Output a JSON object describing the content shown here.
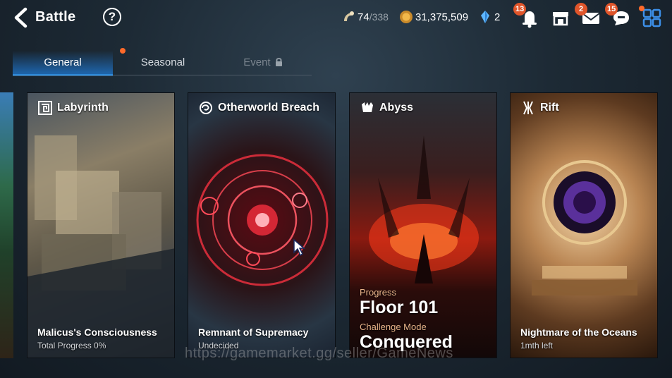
{
  "header": {
    "title": "Battle",
    "help_symbol": "?",
    "stamina": {
      "current": "74",
      "max": "/338"
    },
    "gold": "31,375,509",
    "crystal": "2",
    "badges": {
      "notifications": "13",
      "mail": "2",
      "chat": "15"
    }
  },
  "tabs": [
    {
      "label": "General",
      "active": true
    },
    {
      "label": "Seasonal",
      "active": false,
      "has_dot": true
    },
    {
      "label": "Event",
      "active": false,
      "locked": true
    }
  ],
  "cards": [
    {
      "title": "Labyrinth",
      "icon": "maze-icon",
      "name": "Malicus's Consciousness",
      "sub": "Total Progress 0%"
    },
    {
      "title": "Otherworld Breach",
      "icon": "portal-swirl-icon",
      "name": "Remnant of Supremacy",
      "sub": "Undecided"
    },
    {
      "title": "Abyss",
      "icon": "demon-claw-icon",
      "progress_label": "Progress",
      "progress_value": "Floor 101",
      "challenge_label": "Challenge Mode",
      "challenge_value": "Conquered"
    },
    {
      "title": "Rift",
      "icon": "rift-icon",
      "name": "Nightmare of the Oceans",
      "sub": "1mth left"
    }
  ],
  "watermark": "https://gamemarket.gg/seller/GameNews",
  "colors": {
    "accent_blue": "#2a8fe6",
    "badge_orange": "#e0552a",
    "label_orange": "#e8b48a"
  }
}
